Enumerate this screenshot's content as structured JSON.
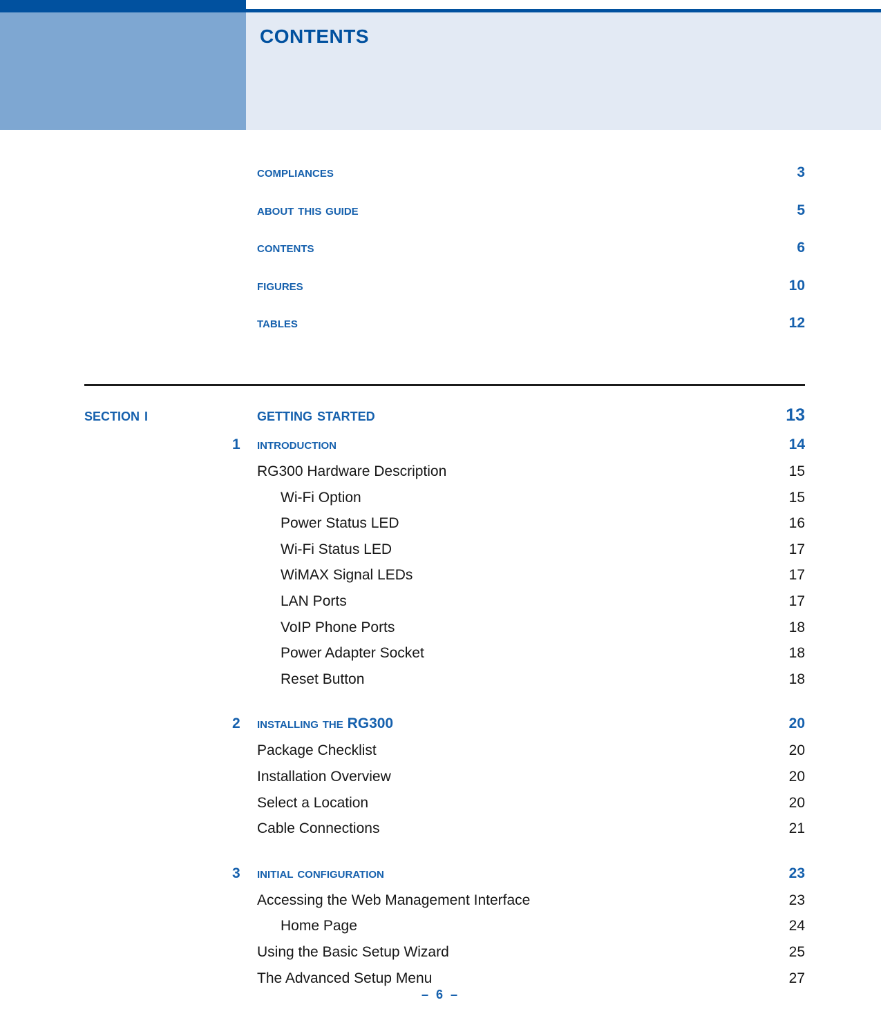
{
  "header": {
    "title": "Contents",
    "accent_dark": "#01519F",
    "accent_mid": "#7EA7D2",
    "panel_bg": "#E3EAF4"
  },
  "front_matter": [
    {
      "label": "Compliances",
      "page": "3"
    },
    {
      "label": "About This Guide",
      "page": "5"
    },
    {
      "label": "Contents",
      "page": "6"
    },
    {
      "label": "Figures",
      "page": "10"
    },
    {
      "label": "Tables",
      "page": "12"
    }
  ],
  "section": {
    "number_label": "Section I",
    "title": "Getting Started",
    "page": "13"
  },
  "chapters": [
    {
      "number": "1",
      "title_pre": "Introduction",
      "title_caps": "",
      "title_post": "",
      "page": "14",
      "entries": [
        {
          "level": 1,
          "label": "RG300 Hardware Description",
          "page": "15"
        },
        {
          "level": 2,
          "label": "Wi-Fi Option",
          "page": "15"
        },
        {
          "level": 2,
          "label": "Power Status LED",
          "page": "16"
        },
        {
          "level": 2,
          "label": "Wi-Fi Status LED",
          "page": "17"
        },
        {
          "level": 2,
          "label": "WiMAX Signal LEDs",
          "page": "17"
        },
        {
          "level": 2,
          "label": "LAN Ports",
          "page": "17"
        },
        {
          "level": 2,
          "label": "VoIP Phone Ports",
          "page": "18"
        },
        {
          "level": 2,
          "label": "Power Adapter Socket",
          "page": "18"
        },
        {
          "level": 2,
          "label": "Reset Button",
          "page": "18"
        }
      ]
    },
    {
      "number": "2",
      "title_pre": "Installing the ",
      "title_caps": "RG300",
      "title_post": "",
      "page": "20",
      "entries": [
        {
          "level": 1,
          "label": "Package Checklist",
          "page": "20"
        },
        {
          "level": 1,
          "label": "Installation Overview",
          "page": "20"
        },
        {
          "level": 1,
          "label": "Select a Location",
          "page": "20"
        },
        {
          "level": 1,
          "label": "Cable Connections",
          "page": "21"
        }
      ]
    },
    {
      "number": "3",
      "title_pre": "Initial Configuration",
      "title_caps": "",
      "title_post": "",
      "page": "23",
      "entries": [
        {
          "level": 1,
          "label": "Accessing the Web Management Interface",
          "page": "23"
        },
        {
          "level": 2,
          "label": "Home Page",
          "page": "24"
        },
        {
          "level": 1,
          "label": "Using the Basic Setup Wizard",
          "page": "25"
        },
        {
          "level": 1,
          "label": "The Advanced Setup Menu",
          "page": "27"
        }
      ]
    }
  ],
  "footer": {
    "page_marker": "–  6  –"
  }
}
